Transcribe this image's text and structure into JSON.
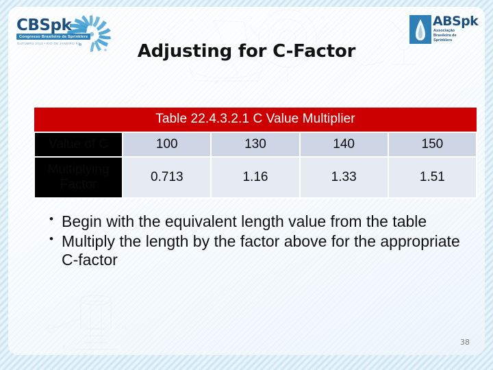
{
  "slide": {
    "title": "Adjusting for C-Factor",
    "page_number": "38",
    "accent_red": "#CC0000",
    "label_black": "#000000",
    "row1_cell_bg": "#ced5e4",
    "row2_cell_bg": "#e6eaf2",
    "logo_blue": "#1d4f7c"
  },
  "logo_left": {
    "name": "CBSpk",
    "subtitle": "Congresso Brasileiro de Sprinklers",
    "date_line": "OUTUBRO 2013 • RIO DE JANEIRO RJ"
  },
  "logo_right": {
    "name": "ABSpk",
    "subtitle": "Associação Brasileira de Sprinklers"
  },
  "table": {
    "caption": "Table 22.4.3.2.1 C Value Multiplier",
    "rows": [
      {
        "label": "Value of C",
        "values": [
          "100",
          "130",
          "140",
          "150"
        ]
      },
      {
        "label": "Multiplying Factor",
        "label_line1": "Multiplying",
        "label_line2": "Factor",
        "values": [
          "0.713",
          "1.16",
          "1.33",
          "1.51"
        ]
      }
    ]
  },
  "bullets": [
    {
      "marker": "•",
      "text": "Begin with the equivalent length value from the table"
    },
    {
      "marker": "•",
      "text": "Multiply the length by the factor above for the appropriate C-factor"
    }
  ]
}
